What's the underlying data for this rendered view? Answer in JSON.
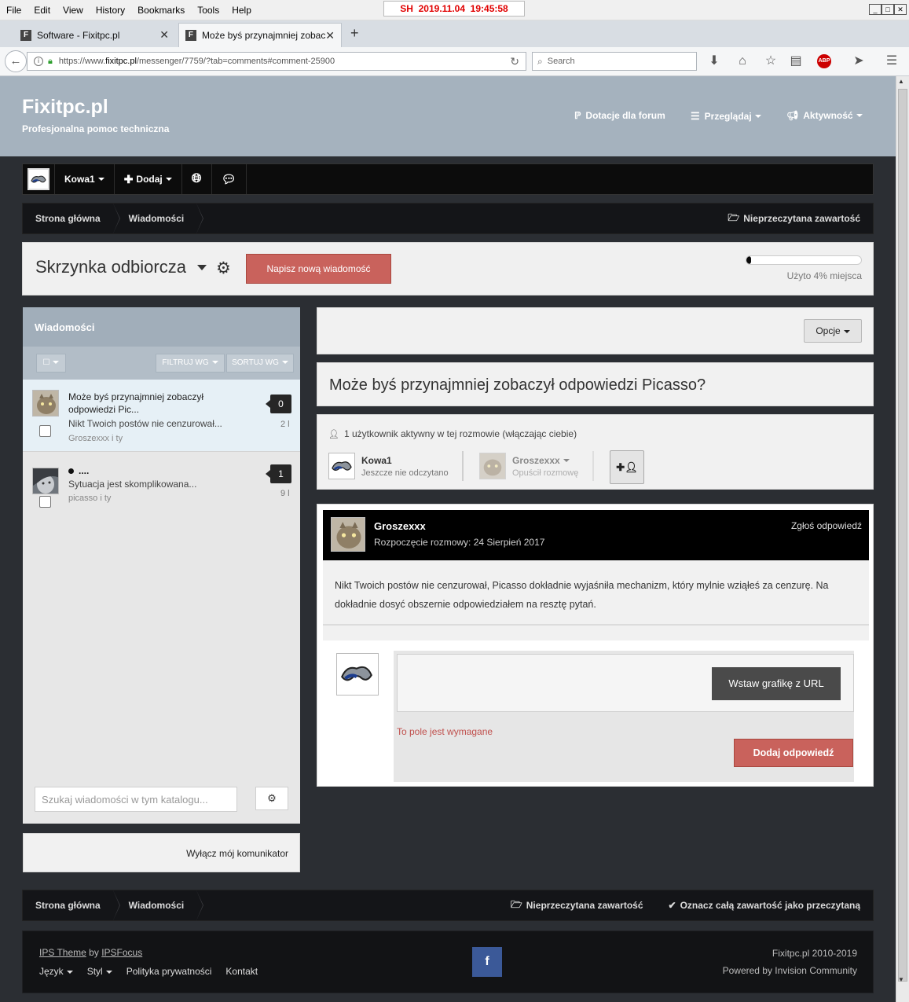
{
  "browser": {
    "menu": [
      "File",
      "Edit",
      "View",
      "History",
      "Bookmarks",
      "Tools",
      "Help"
    ],
    "stamp": "SH  2019.11.04  19:45:58",
    "tabs": [
      {
        "label": "Software - Fixitpc.pl"
      },
      {
        "label": "Może byś przynajmniej zobac..."
      }
    ],
    "url_prefix": "https://www.",
    "url_domain": "fixitpc.pl",
    "url_path": "/messenger/7759/?tab=comments#comment-25900",
    "search_placeholder": "Search",
    "adblock_label": "ABP"
  },
  "site": {
    "title": "Fixitpc.pl",
    "subtitle": "Profesjonalna pomoc techniczna",
    "nav": {
      "donate": "Dotacje dla forum",
      "browse": "Przeglądaj",
      "activity": "Aktywność"
    }
  },
  "userbar": {
    "username": "Kowa1",
    "add": "Dodaj"
  },
  "breadcrumbs": {
    "home": "Strona główna",
    "messages": "Wiadomości",
    "unread": "Nieprzeczytana zawartość",
    "mark_read": "Oznacz całą zawartość jako przeczytaną"
  },
  "inbox": {
    "title": "Skrzynka odbiorcza",
    "new_message": "Napisz nową wiadomość",
    "quota_percent": 4,
    "quota_text": "Użyto 4% miejsca"
  },
  "messages_panel": {
    "title": "Wiadomości",
    "filter": "FILTRUJ WG",
    "sort": "SORTUJ WG",
    "items": [
      {
        "subject": "Może byś przynajmniej zobaczył odpowiedzi Pic...",
        "snippet": "Nikt Twoich postów nie cenzurował...",
        "participants": "Groszexxx i ty",
        "count": "0",
        "time": "2 l"
      },
      {
        "subject": "....",
        "snippet": "Sytuacja jest skomplikowana...",
        "participants": "picasso i ty",
        "count": "1",
        "time": "9 l"
      }
    ],
    "search_placeholder": "Szukaj wiadomości w tym katalogu..."
  },
  "messenger_toggle": "Wyłącz mój komunikator",
  "conversation": {
    "options": "Opcje",
    "title": "Może byś przynajmniej zobaczył odpowiedzi Picasso?",
    "active_users": "1 użytkownik aktywny w tej rozmowie (włączając ciebie)",
    "participants": [
      {
        "name": "Kowa1",
        "status": "Jeszcze nie odczytano"
      },
      {
        "name": "Groszexxx",
        "status": "Opuścił rozmowę"
      }
    ],
    "post": {
      "author": "Groszexxx",
      "started": "Rozpoczęcie rozmowy: 24 Sierpień 2017",
      "report": "Zgłoś odpowiedź",
      "body": "Nikt Twoich postów nie cenzurował, Picasso dokładnie wyjaśniła mechanizm, który mylnie wziąłeś za cenzurę. Na dokładnie dosyć obszernie odpowiedziałem na resztę pytań."
    },
    "reply": {
      "insert_image": "Wstaw grafikę z URL",
      "required": "To pole jest wymagane",
      "submit": "Dodaj odpowiedź"
    }
  },
  "footer": {
    "theme_prefix": "IPS Theme",
    "theme_by": "by",
    "theme_author": "IPSFocus",
    "language": "Język",
    "style": "Styl",
    "privacy": "Polityka prywatności",
    "contact": "Kontakt",
    "facebook": "f",
    "copyright": "Fixitpc.pl 2010-2019",
    "powered": "Powered by Invision Community"
  },
  "colors": {
    "accent": "#c9625c",
    "header": "#a5b2be",
    "dark": "#0c0c0c"
  }
}
